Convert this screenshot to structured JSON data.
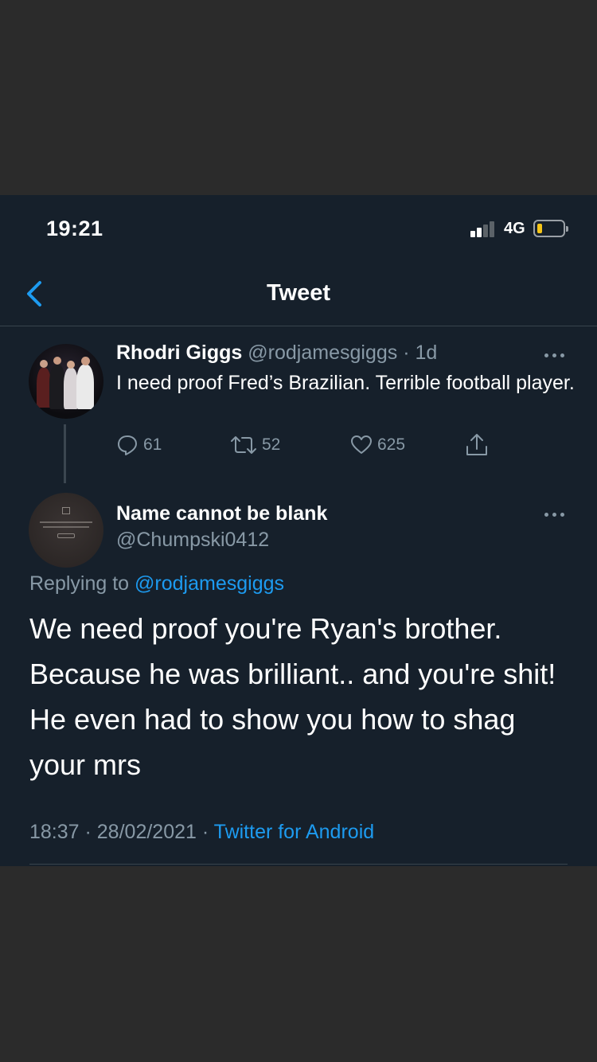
{
  "status_bar": {
    "time": "19:21",
    "network": "4G",
    "signal_bars_active": 2,
    "signal_bars_total": 4,
    "battery_color": "#f5c518"
  },
  "nav": {
    "title": "Tweet",
    "back_icon": "chevron-left-icon",
    "accent": "#1d9bf0"
  },
  "parent_tweet": {
    "name": "Rhodri Giggs",
    "handle": "@rodjamesgiggs",
    "separator": "·",
    "age": "1d",
    "text": "I need proof Fred’s Brazilian. Terrible football player.",
    "more_icon": "more-horizontal-icon",
    "actions": {
      "reply_count": "61",
      "retweet_count": "52",
      "like_count": "625"
    }
  },
  "main_tweet": {
    "name": "Name cannot be blank",
    "handle": "@Chumpski0412",
    "replying_prefix": "Replying to",
    "replying_to": "@rodjamesgiggs",
    "text": "We need proof you're Ryan's brother. Because he was brilliant..  and you're shit! He even had to show you how to shag your mrs",
    "time": "18:37",
    "date": "28/02/2021",
    "source": "Twitter for Android",
    "separator": " · "
  },
  "colors": {
    "background": "#16202b",
    "outer": "#2b2b2b",
    "secondary_text": "#8899a6",
    "link": "#1d9bf0",
    "divider": "#38444d"
  }
}
